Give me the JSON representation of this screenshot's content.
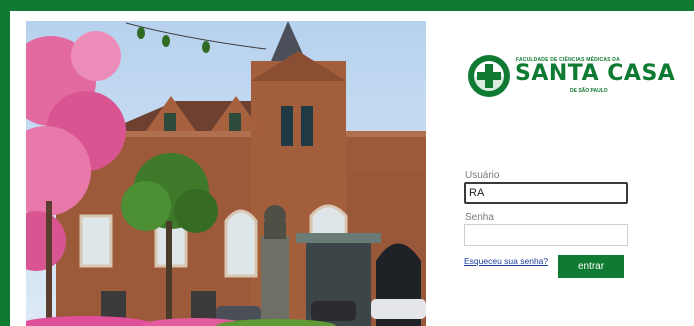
{
  "logo": {
    "small_text": "FACULDADE DE CIÊNCIAS MÉDICAS DA",
    "big_text": "SANTA CASA",
    "city_text": "DE SÃO PAULO"
  },
  "login": {
    "user_label": "Usuário",
    "user_value": "RA",
    "password_label": "Senha",
    "password_value": "",
    "forgot_link": "Esqueceu sua senha?",
    "submit_label": "entrar"
  },
  "colors": {
    "brand": "#0f7a32",
    "link": "#1a3c9a"
  },
  "icons": {
    "logo_mark": "medical-cross-icon"
  }
}
